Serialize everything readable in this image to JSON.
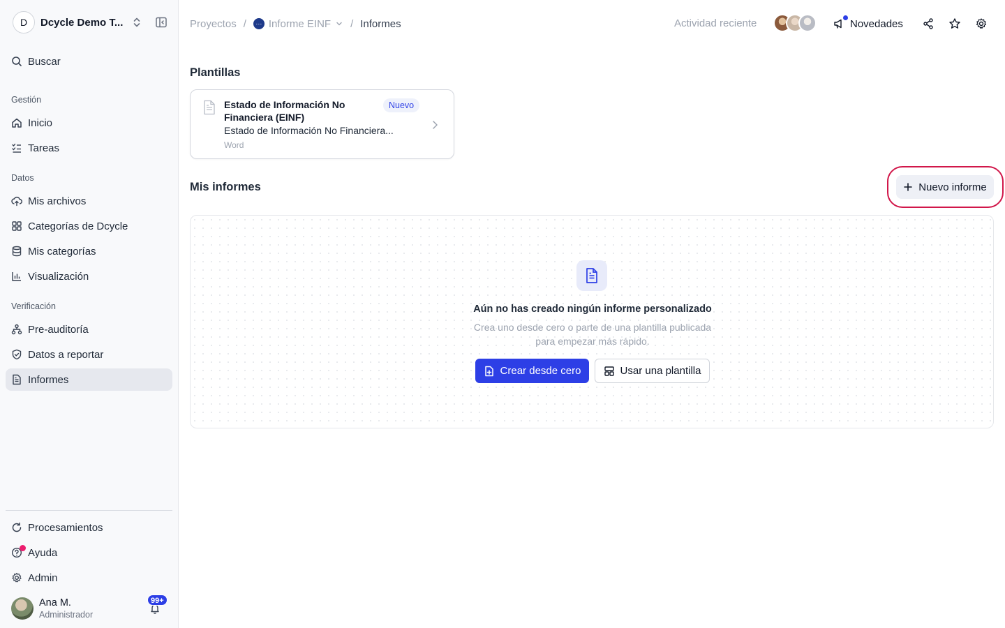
{
  "workspace": {
    "initial": "D",
    "name": "Dcycle Demo T..."
  },
  "sidebar": {
    "search": "Buscar",
    "sections": [
      {
        "label": "Gestión",
        "items": [
          {
            "label": "Inicio",
            "icon": "home-icon"
          },
          {
            "label": "Tareas",
            "icon": "tasks-icon"
          }
        ]
      },
      {
        "label": "Datos",
        "items": [
          {
            "label": "Mis archivos",
            "icon": "upload-cloud-icon"
          },
          {
            "label": "Categorías de Dcycle",
            "icon": "grid-icon"
          },
          {
            "label": "Mis categorías",
            "icon": "database-icon"
          },
          {
            "label": "Visualización",
            "icon": "bar-chart-icon"
          }
        ]
      },
      {
        "label": "Verificación",
        "items": [
          {
            "label": "Pre-auditoría",
            "icon": "sitemap-icon"
          },
          {
            "label": "Datos a reportar",
            "icon": "shield-check-icon"
          },
          {
            "label": "Informes",
            "icon": "document-icon",
            "active": true
          }
        ]
      }
    ],
    "bottom": [
      {
        "label": "Procesamientos",
        "icon": "refresh-icon"
      },
      {
        "label": "Ayuda",
        "icon": "help-icon"
      },
      {
        "label": "Admin",
        "icon": "gear-icon"
      }
    ],
    "user": {
      "name": "Ana M.",
      "role": "Administrador",
      "notifications": "99+"
    }
  },
  "breadcrumb": {
    "root": "Proyectos",
    "project": "Informe EINF",
    "current": "Informes",
    "separator": "/"
  },
  "topbar": {
    "recent": "Actividad reciente",
    "news": "Novedades"
  },
  "templates": {
    "heading": "Plantillas",
    "card": {
      "title": "Estado de Información No Financiera (EINF)",
      "badge": "Nuevo",
      "description": "Estado de Información No Financiera...",
      "type": "Word"
    }
  },
  "reports": {
    "heading": "Mis informes",
    "new_button": "Nuevo informe",
    "empty": {
      "title": "Aún no has creado ningún informe personalizado",
      "subtitle": "Crea uno desde cero o parte de una plantilla publicada para empezar más rápido.",
      "primary": "Crear desde cero",
      "secondary": "Usar una plantilla"
    }
  },
  "colors": {
    "accent": "#2d3fe6",
    "highlight": "#d1174a",
    "notification_dot": "#ec1d6e"
  }
}
